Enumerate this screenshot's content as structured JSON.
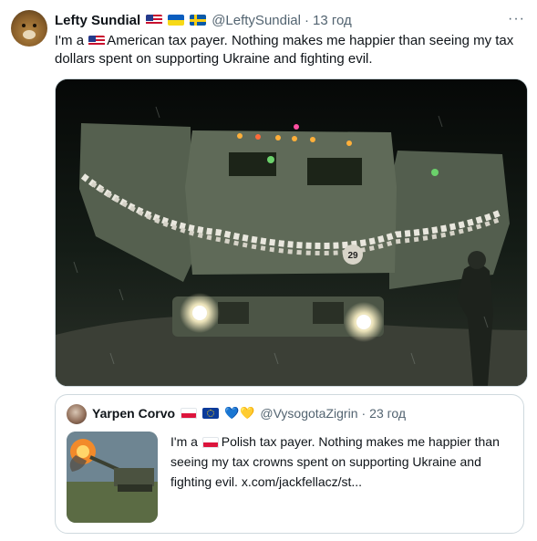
{
  "tweet": {
    "author_name": "Lefty Sundial",
    "author_handle": "@LeftySundial",
    "separator": "·",
    "time": "13 год",
    "more_label": "···",
    "text_before": "I'm a",
    "text_after": "American tax payer. Nothing makes me happier than seeing my tax dollars spent on supporting Ukraine and fighting evil.",
    "header_flags": [
      "flag-us-icon",
      "flag-ukraine-icon",
      "flag-sweden-icon"
    ],
    "media_plate": "29"
  },
  "quote": {
    "author_name": "Yarpen Corvo",
    "author_handle": "@VysogotaZigrin",
    "separator": "·",
    "time": "23 год",
    "hearts": [
      "💙",
      "💛"
    ],
    "text_before": "I'm a",
    "text_after": "Polish tax payer. Nothing makes me happier than seeing my tax crowns spent on supporting Ukraine and fighting evil.  x.com/jackfellacz/st..."
  },
  "colors": {
    "text_primary": "#0f1419",
    "text_secondary": "#536471",
    "border": "#cfd9de"
  }
}
